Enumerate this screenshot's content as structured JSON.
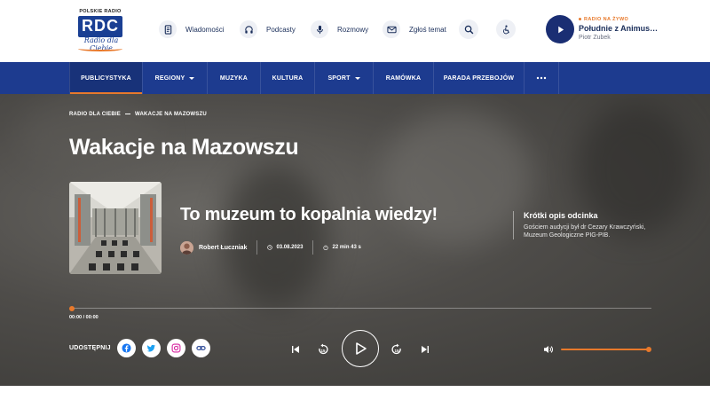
{
  "logo": {
    "top_text": "POLSKIE RADIO",
    "letters": "RDC",
    "script_text": "Radio dla Ciebie"
  },
  "topnav": {
    "items": [
      {
        "label": "Wiadomości",
        "icon": "document-icon"
      },
      {
        "label": "Podcasty",
        "icon": "headphones-icon"
      },
      {
        "label": "Rozmowy",
        "icon": "microphone-icon"
      },
      {
        "label": "Zgłoś temat",
        "icon": "envelope-icon"
      }
    ],
    "search_icon": "search-icon",
    "accessibility_icon": "accessibility-icon"
  },
  "live": {
    "tag": "RADIO NA ŻYWO",
    "title": "Południe z Animuszem",
    "host": "Piotr Zubek"
  },
  "mainnav": {
    "items": [
      {
        "label": "PUBLICYSTYKA",
        "active": true
      },
      {
        "label": "REGIONY",
        "dropdown": true
      },
      {
        "label": "MUZYKA"
      },
      {
        "label": "KULTURA"
      },
      {
        "label": "SPORT",
        "dropdown": true
      },
      {
        "label": "RAMÓWKA"
      },
      {
        "label": "PARADA PRZEBOJÓW"
      }
    ],
    "more_icon": "more-dots-icon"
  },
  "breadcrumb": {
    "items": [
      "RADIO DLA CIEBIE",
      "WAKACJE NA MAZOWSZU"
    ]
  },
  "page": {
    "title": "Wakacje na Mazowszu"
  },
  "episode": {
    "title": "To muzeum to kopalnia wiedzy!",
    "author": "Robert Łuczniak",
    "date": "03.08.2023",
    "duration": "22 min 43 s"
  },
  "description": {
    "heading": "Krótki opis odcinka",
    "text": "Gościem audycji był dr Cezary Krawczyński, Muzeum Geologiczne PIG-PIB."
  },
  "player": {
    "time": "00:00 / 00:00",
    "progress": 0,
    "volume": 1.0,
    "share_label": "UDOSTĘPNIJ",
    "share_buttons": [
      "facebook-icon",
      "twitter-icon",
      "instagram-icon",
      "link-icon"
    ]
  },
  "colors": {
    "navy": "#1d3b8f",
    "accent": "#e8792b",
    "text_dark": "#1a2e5a"
  }
}
